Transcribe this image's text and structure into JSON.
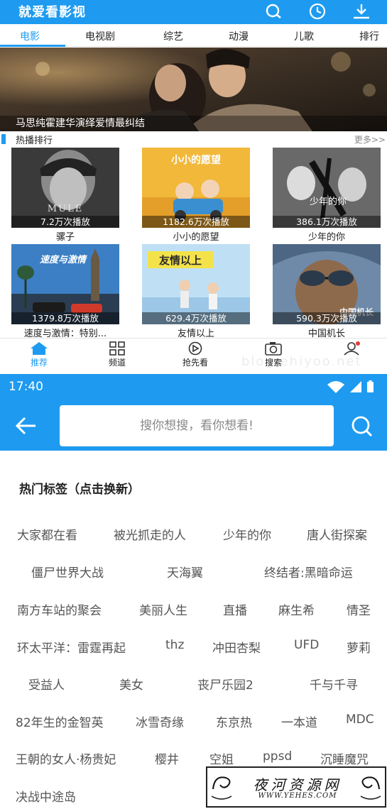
{
  "app": {
    "title": "就爱看影视"
  },
  "tabs": [
    "电影",
    "电视剧",
    "综艺",
    "动漫",
    "儿歌",
    "排行"
  ],
  "banner": {
    "caption": "马思纯霍建华演绎爱情最纠结"
  },
  "section": {
    "title": "热播排行",
    "more": "更多>>"
  },
  "movies": [
    {
      "title": "骡子",
      "plays": "7.2万次播放",
      "poster_text": "MULE"
    },
    {
      "title": "小小的愿望",
      "plays": "1182.6万次播放",
      "poster_text": "小小的愿望"
    },
    {
      "title": "少年的你",
      "plays": "386.1万次播放",
      "poster_text": "少年的你"
    },
    {
      "title": "速度与激情：特别...",
      "plays": "1379.8万次播放",
      "poster_text": "速度与激情"
    },
    {
      "title": "友情以上",
      "plays": "629.4万次播放",
      "poster_text": "友情以上"
    },
    {
      "title": "中国机长",
      "plays": "590.3万次播放",
      "poster_text": "中国机长"
    }
  ],
  "bottom_nav": [
    "推荐",
    "频道",
    "抢先看",
    "搜索",
    ""
  ],
  "watermark_faint": "blog.ehiyoo.net",
  "status_bar": {
    "time": "17:40"
  },
  "search": {
    "placeholder": "搜你想搜，看你想看!"
  },
  "hot_tags": {
    "title": "热门标签（点击换新）",
    "tags": [
      "大家都在看",
      "被光抓走的人",
      "少年的你",
      "唐人街探案",
      "僵尸世界大战",
      "天海翼",
      "终结者:黑暗命运",
      "南方车站的聚会",
      "美丽人生",
      "直播",
      "麻生希",
      "情圣",
      "环太平洋：雷霆再起",
      "thz",
      "冲田杏梨",
      "UFD",
      "萝莉",
      "受益人",
      "美女",
      "丧尸乐园2",
      "千与千寻",
      "82年生的金智英",
      "冰雪奇缘",
      "东京热",
      "一本道",
      "MDC",
      "王朝的女人·杨贵妃",
      "樱井",
      "空姐",
      "ppsd",
      "沉睡魔咒",
      "决战中途岛"
    ]
  },
  "logo": {
    "cn": "夜河资源网",
    "en": "WWW.YEHES.COM"
  },
  "colors": {
    "primary": "#1e9bf0",
    "tag_text": "#555555"
  }
}
